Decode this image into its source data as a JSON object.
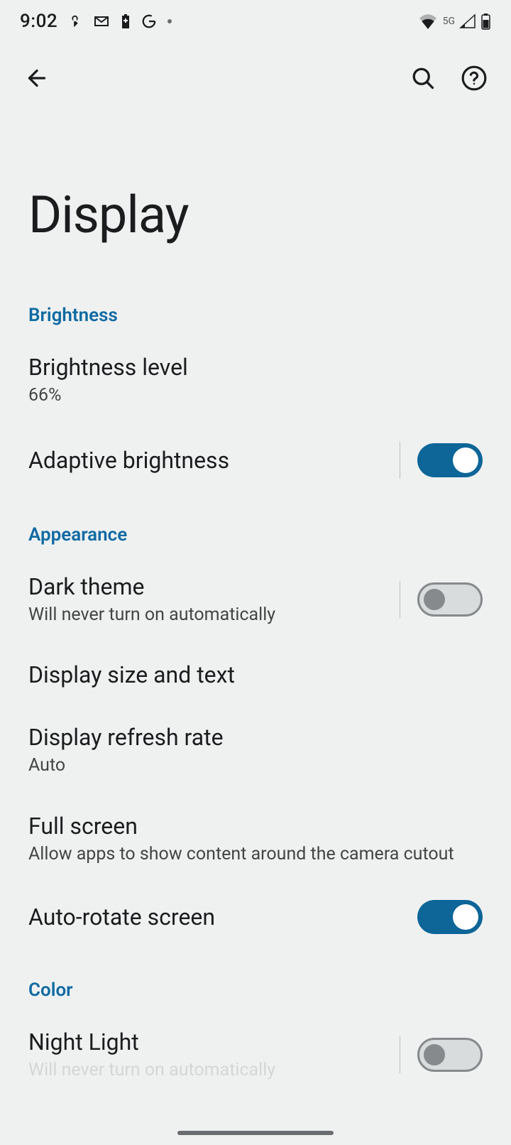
{
  "status": {
    "time": "9:02",
    "network_label": "5G"
  },
  "header": {
    "title": "Display"
  },
  "sections": {
    "brightness": {
      "header": "Brightness",
      "brightness_level": {
        "title": "Brightness level",
        "value": "66%"
      },
      "adaptive": {
        "title": "Adaptive brightness",
        "on": true
      }
    },
    "appearance": {
      "header": "Appearance",
      "dark_theme": {
        "title": "Dark theme",
        "sub": "Will never turn on automatically",
        "on": false
      },
      "display_size": {
        "title": "Display size and text"
      },
      "refresh_rate": {
        "title": "Display refresh rate",
        "value": "Auto"
      },
      "full_screen": {
        "title": "Full screen",
        "sub": "Allow apps to show content around the camera cutout"
      },
      "auto_rotate": {
        "title": "Auto-rotate screen",
        "on": true
      }
    },
    "color": {
      "header": "Color",
      "night_light": {
        "title": "Night Light",
        "sub": "Will never turn on automatically",
        "on": false
      }
    }
  }
}
